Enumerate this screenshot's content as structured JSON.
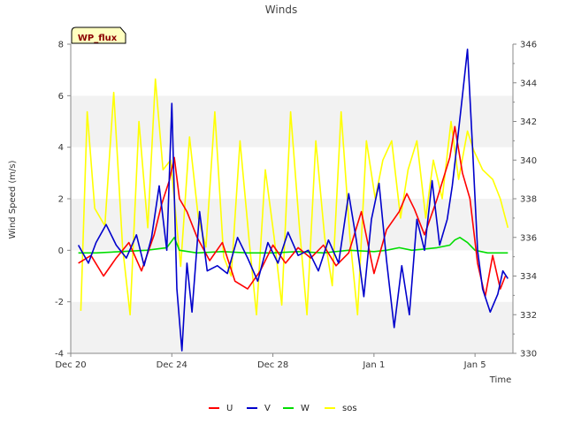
{
  "chart_data": {
    "type": "line",
    "title": "Winds",
    "badge": "WP_flux",
    "xlabel": "Time",
    "ylabel": "Wind Speed (m/s)",
    "ylim": [
      -4,
      8
    ],
    "y2lim": [
      330,
      346
    ],
    "yticks": [
      -4,
      -2,
      0,
      2,
      4,
      6,
      8
    ],
    "y2ticks": [
      330,
      332,
      334,
      336,
      338,
      340,
      342,
      344,
      346
    ],
    "xlim": [
      0,
      17.5
    ],
    "xticks": [
      {
        "x": 0,
        "label": "Dec 20"
      },
      {
        "x": 4,
        "label": "Dec 24"
      },
      {
        "x": 8,
        "label": "Dec 28"
      },
      {
        "x": 12,
        "label": "Jan 1"
      },
      {
        "x": 16,
        "label": "Jan 5"
      }
    ],
    "grid": "horizontal bands",
    "legend": "bottom-center",
    "series": [
      {
        "name": "U",
        "color": "#ff0000",
        "axis": "left",
        "x": [
          0.3,
          0.8,
          1.3,
          1.8,
          2.3,
          2.8,
          3.3,
          3.6,
          3.9,
          4.1,
          4.3,
          4.6,
          5.0,
          5.5,
          6.0,
          6.5,
          7.0,
          7.5,
          8.0,
          8.5,
          9.0,
          9.5,
          10.0,
          10.5,
          11.0,
          11.5,
          12.0,
          12.5,
          13.0,
          13.3,
          13.6,
          14.0,
          14.5,
          15.0,
          15.2,
          15.5,
          15.8,
          16.1,
          16.4,
          16.7,
          17.0,
          17.2
        ],
        "values": [
          -0.5,
          -0.2,
          -1.0,
          -0.3,
          0.3,
          -0.8,
          0.6,
          1.8,
          2.7,
          3.6,
          2.0,
          1.5,
          0.5,
          -0.4,
          0.3,
          -1.2,
          -1.5,
          -0.8,
          0.2,
          -0.5,
          0.1,
          -0.3,
          0.2,
          -0.6,
          -0.1,
          1.5,
          -0.9,
          0.8,
          1.5,
          2.2,
          1.6,
          0.6,
          2.0,
          3.6,
          4.8,
          3.0,
          2.0,
          -0.5,
          -1.8,
          -0.2,
          -1.5,
          -1.0
        ]
      },
      {
        "name": "V",
        "color": "#0000cc",
        "axis": "left",
        "x": [
          0.3,
          0.7,
          1.0,
          1.4,
          1.8,
          2.2,
          2.6,
          2.9,
          3.2,
          3.5,
          3.8,
          4.0,
          4.2,
          4.4,
          4.6,
          4.8,
          5.1,
          5.4,
          5.8,
          6.2,
          6.6,
          7.0,
          7.4,
          7.8,
          8.2,
          8.6,
          9.0,
          9.4,
          9.8,
          10.2,
          10.6,
          11.0,
          11.3,
          11.6,
          11.9,
          12.2,
          12.5,
          12.8,
          13.1,
          13.4,
          13.7,
          14.0,
          14.3,
          14.6,
          14.9,
          15.1,
          15.3,
          15.5,
          15.7,
          15.9,
          16.1,
          16.3,
          16.6,
          16.9,
          17.1,
          17.3
        ],
        "values": [
          0.2,
          -0.5,
          0.3,
          1.0,
          0.2,
          -0.3,
          0.6,
          -0.6,
          0.5,
          2.5,
          0.0,
          5.7,
          -1.5,
          -3.9,
          -0.5,
          -2.4,
          1.5,
          -0.8,
          -0.6,
          -0.9,
          0.5,
          -0.3,
          -1.2,
          0.3,
          -0.5,
          0.7,
          -0.2,
          0.0,
          -0.8,
          0.4,
          -0.5,
          2.2,
          0.4,
          -1.8,
          1.2,
          2.6,
          -0.4,
          -3.0,
          -0.6,
          -2.5,
          1.2,
          0.0,
          2.7,
          0.2,
          1.2,
          2.5,
          4.2,
          6.0,
          7.8,
          4.0,
          0.0,
          -1.5,
          -2.4,
          -1.7,
          -0.8,
          -1.1
        ]
      },
      {
        "name": "W",
        "color": "#00dd00",
        "axis": "left",
        "x": [
          0.3,
          1.0,
          2.0,
          3.0,
          3.8,
          4.1,
          4.3,
          5.0,
          6.0,
          7.0,
          8.0,
          9.0,
          10.0,
          11.0,
          12.0,
          12.5,
          13.0,
          13.5,
          14.0,
          14.5,
          15.0,
          15.2,
          15.4,
          15.7,
          16.0,
          16.5,
          17.0,
          17.3
        ],
        "values": [
          -0.1,
          -0.1,
          -0.05,
          0.0,
          0.1,
          0.5,
          0.0,
          -0.1,
          -0.05,
          -0.1,
          -0.1,
          -0.05,
          -0.1,
          0.0,
          -0.05,
          0.0,
          0.1,
          0.0,
          0.05,
          0.1,
          0.2,
          0.4,
          0.5,
          0.3,
          0.0,
          -0.1,
          -0.1,
          -0.1
        ]
      },
      {
        "name": "sos",
        "color": "#ffff00",
        "axis": "right",
        "x": [
          0.4,
          0.65,
          0.95,
          1.35,
          1.7,
          2.05,
          2.35,
          2.7,
          3.05,
          3.35,
          3.65,
          3.95,
          4.35,
          4.7,
          5.05,
          5.35,
          5.7,
          6.05,
          6.35,
          6.7,
          7.05,
          7.35,
          7.7,
          8.05,
          8.35,
          8.7,
          9.05,
          9.35,
          9.7,
          10.05,
          10.35,
          10.7,
          11.05,
          11.35,
          11.7,
          12.05,
          12.35,
          12.7,
          13.05,
          13.35,
          13.7,
          14.05,
          14.35,
          14.7,
          15.05,
          15.35,
          15.7,
          15.95,
          16.3,
          16.7,
          17.0,
          17.3
        ],
        "values": [
          332.2,
          342.5,
          337.5,
          336.6,
          343.5,
          335.5,
          332.0,
          342.0,
          336.5,
          344.2,
          339.5,
          340.0,
          334.5,
          341.2,
          337.0,
          335.5,
          342.5,
          335.0,
          334.0,
          341.0,
          336.0,
          332.0,
          339.5,
          336.0,
          332.5,
          342.5,
          336.5,
          332.0,
          341.0,
          336.0,
          333.5,
          342.5,
          336.0,
          332.0,
          341.0,
          338.0,
          340.0,
          341.0,
          337.0,
          339.5,
          341.0,
          337.0,
          340.0,
          338.0,
          342.0,
          339.0,
          341.5,
          340.5,
          339.5,
          339.0,
          338.0,
          336.5
        ]
      }
    ]
  }
}
